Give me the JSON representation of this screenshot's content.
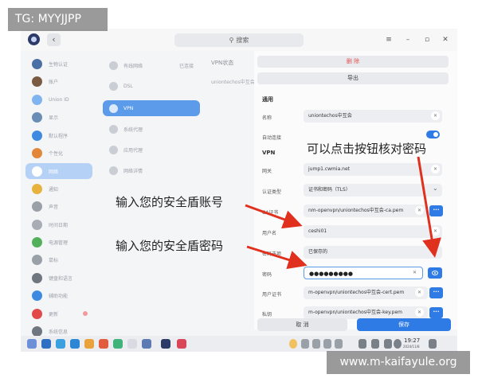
{
  "watermarks": {
    "top": "TG: MYYJJPP",
    "bottom": "www.m-kaifayule.org"
  },
  "window": {
    "search_placeholder": "搜索",
    "back_icon": "chevron-left-icon"
  },
  "sidebar": {
    "items": [
      {
        "label": "生物认证",
        "icon": "fingerprint-icon",
        "color": "#4a6fa5"
      },
      {
        "label": "账户",
        "icon": "user-icon",
        "color": "#7a5a40"
      },
      {
        "label": "Union ID",
        "icon": "cloud-icon",
        "color": "#7fb4f0"
      },
      {
        "label": "显示",
        "icon": "display-icon",
        "color": "#6a8db5"
      },
      {
        "label": "默认程序",
        "icon": "apps-icon",
        "color": "#3e8ae0"
      },
      {
        "label": "个性化",
        "icon": "palette-icon",
        "color": "#e2873a"
      },
      {
        "label": "网络",
        "icon": "globe-icon",
        "color": "#ffffff",
        "active": true
      },
      {
        "label": "通知",
        "icon": "bell-icon",
        "color": "#e7b23d"
      },
      {
        "label": "声音",
        "icon": "speaker-icon",
        "color": "#9aa0a8"
      },
      {
        "label": "时间日期",
        "icon": "clock-icon",
        "color": "#a8adb5"
      },
      {
        "label": "电源管理",
        "icon": "battery-icon",
        "color": "#52b05b"
      },
      {
        "label": "鼠标",
        "icon": "mouse-icon",
        "color": "#9aa0a8"
      },
      {
        "label": "键盘和语言",
        "icon": "keyboard-icon",
        "color": "#6f7680"
      },
      {
        "label": "辅助功能",
        "icon": "accessibility-icon",
        "color": "#3e8ae0"
      },
      {
        "label": "更新",
        "icon": "update-icon",
        "color": "#e24a4a",
        "badge": true
      },
      {
        "label": "系统信息",
        "icon": "info-icon",
        "color": "#6f7680"
      }
    ]
  },
  "network": {
    "items": [
      {
        "label": "有线网络",
        "status": "已连接",
        "icon": "ethernet-icon"
      },
      {
        "label": "DSL",
        "status": "",
        "icon": "dsl-icon"
      },
      {
        "label": "VPN",
        "status": "",
        "icon": "vpn-icon",
        "active": true
      },
      {
        "label": "系统代理",
        "status": "",
        "icon": "proxy-icon"
      },
      {
        "label": "应用代理",
        "status": "",
        "icon": "app-proxy-icon"
      },
      {
        "label": "网络详情",
        "status": "",
        "icon": "network-details-icon"
      }
    ]
  },
  "vpn_list": {
    "title": "VPN状态",
    "connection": "uniontechos中互会"
  },
  "form": {
    "delete_label": "删 除",
    "export_label": "导出",
    "general_title": "通用",
    "name_label": "名称",
    "name_value": "uniontechos中互会",
    "autoconnect_label": "自动连接",
    "autoconnect_on": true,
    "vpn_title": "VPN",
    "gateway_label": "网关",
    "gateway_value": "jump1.cwmia.net",
    "auth_type_label": "认证类型",
    "auth_type_value": "证书和密码（TLS）",
    "ca_label": "CA证书",
    "ca_value": "nm-openvpn/uniontechos中互会-ca.pem",
    "username_label": "用户名",
    "username_value": "ceshi01",
    "pw_option_label": "密码选项",
    "pw_option_value": "已保存的",
    "password_label": "密码",
    "password_value": "●●●●●●●●●",
    "user_cert_label": "用户证书",
    "user_cert_value": "m-openvpn/uniontechos中互会-cert.pem",
    "private_key_label": "私钥",
    "private_key_value": "m-openvpn/uniontechos中互会-key.pem",
    "cancel_label": "取 消",
    "save_label": "保存"
  },
  "taskbar": {
    "time": "19:27",
    "date": "2024/11/8"
  },
  "annotations": {
    "check_password": "可以点击按钮核对密码",
    "enter_account": "输入您的安全盾账号",
    "enter_password": "输入您的安全盾密码",
    "arrow_color": "#e0301e"
  }
}
